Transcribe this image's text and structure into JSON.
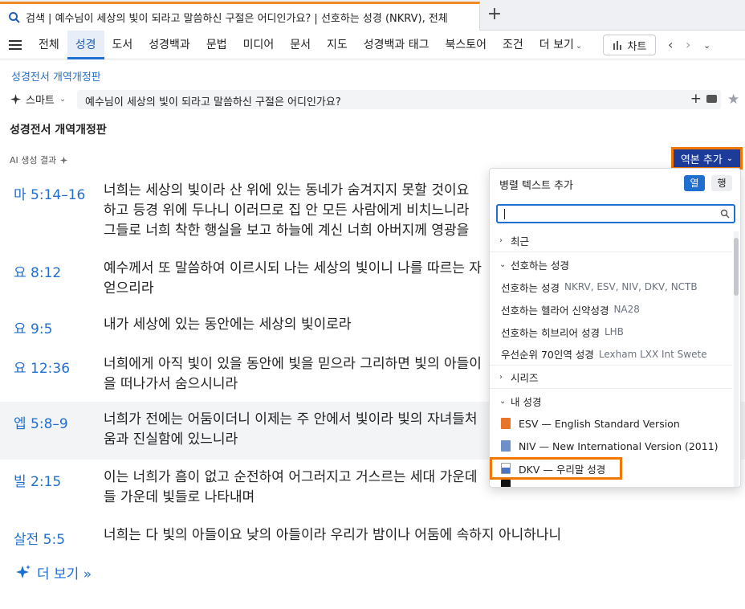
{
  "tab": {
    "title": "검색 | 예수님이 세상의 빛이 되라고 말씀하신 구절은 어디인가요? | 선호하는 성경 (NKRV), 전체",
    "new_tab_label": "+"
  },
  "nav": {
    "items": [
      {
        "label": "전체"
      },
      {
        "label": "성경"
      },
      {
        "label": "도서"
      },
      {
        "label": "성경백과"
      },
      {
        "label": "문법"
      },
      {
        "label": "미디어"
      },
      {
        "label": "문서"
      },
      {
        "label": "지도"
      },
      {
        "label": "성경백과 태그"
      },
      {
        "label": "북스토어"
      },
      {
        "label": "조건"
      },
      {
        "label": "더 보기"
      }
    ],
    "active_index": 1,
    "chart_label": "차트"
  },
  "resource_link": "성경전서 개역개정판",
  "search": {
    "mode": "스마트",
    "query": "예수님이 세상의 빛이 되라고 말씀하신 구절은 어디인가요?"
  },
  "section_title": "성경전서 개역개정판",
  "ai_label": "AI 생성 결과",
  "add_version_label": "역본 추가",
  "results": [
    {
      "ref": "마 5:14–16",
      "text": "너희는 세상의 빛이라 산 위에 있는 동네가 숨겨지지 못할 것이요\n하고 등경 위에 두나니 이러므로 집 안 모든 사람에게 비치느니라\n그들로 너희 착한 행실을 보고 하늘에 계신 너희 아버지께 영광을"
    },
    {
      "ref": "요 8:12",
      "text": "예수께서 또 말씀하여 이르시되 나는 세상의 빛이니 나를 따르는 자\n얻으리라"
    },
    {
      "ref": "요 9:5",
      "text": "내가 세상에 있는 동안에는 세상의 빛이로라"
    },
    {
      "ref": "요 12:36",
      "text": "너희에게 아직 빛이 있을 동안에 빛을 믿으라 그리하면 빛의 아들이\n을 떠나가서 숨으시니라"
    },
    {
      "ref": "엡 5:8–9",
      "text": "너희가 전에는 어둠이더니 이제는 주 안에서 빛이라 빛의 자녀들처\n움과 진실함에 있느니라"
    },
    {
      "ref": "빌 2:15",
      "text": "이는 너희가 흠이 없고 순전하여 어그러지고 거스르는 세대 가운데\n들 가운데 빛들로 나타내며"
    },
    {
      "ref": "살전 5:5",
      "text": "너희는 다 빛의 아들이요 낮의 아들이라 우리가 밤이나 어둠에 속하지 아니하나니"
    }
  ],
  "more_label": "더 보기 »",
  "panel": {
    "title": "병렬 텍스트 추가",
    "toggle_col": "열",
    "toggle_row": "행",
    "groups": {
      "recent": "최근",
      "preferred": "선호하는 성경",
      "series": "시리즈",
      "my_bibles": "내 성경"
    },
    "preferred_items": [
      {
        "name": "선호하는 성경",
        "sub": "NKRV, ESV, NIV, DKV, NCTB"
      },
      {
        "name": "선호하는 헬라어 신약성경",
        "sub": "NA28"
      },
      {
        "name": "선호하는 히브리어 성경",
        "sub": "LHB"
      },
      {
        "name": "우선순위 70인역 성경",
        "sub": "Lexham LXX Int Swete"
      }
    ],
    "my_bibles": [
      {
        "name": "ESV — English Standard Version",
        "color": "#e8742a"
      },
      {
        "name": "NIV — New International Version (2011)",
        "color": "#6f8fc9"
      },
      {
        "name": "DKV — 우리말 성경",
        "color": "#4a73c6"
      }
    ]
  }
}
